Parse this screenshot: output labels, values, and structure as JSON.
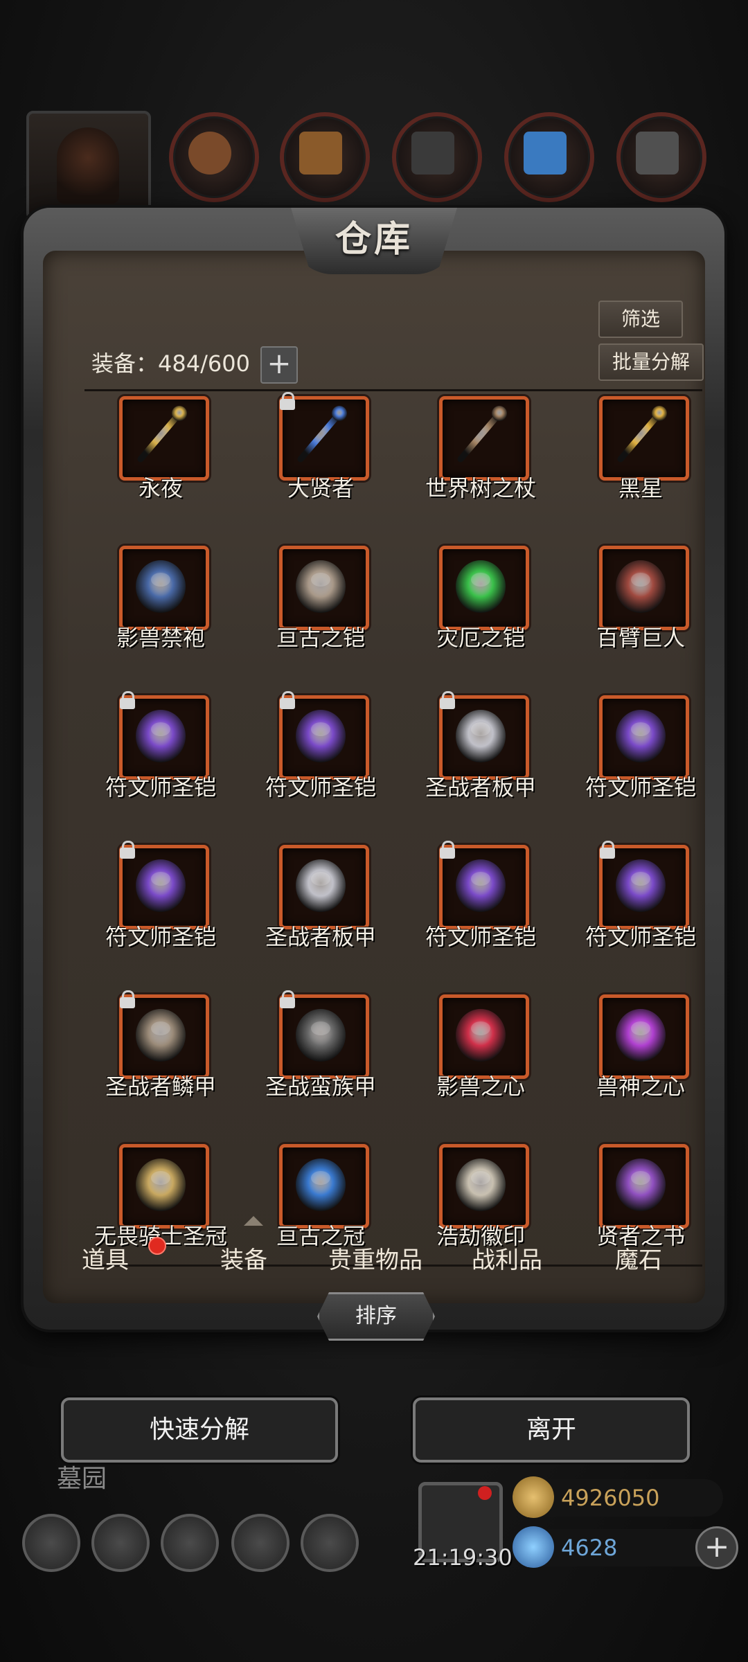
{
  "panel": {
    "title": "仓库",
    "filter_label": "筛选",
    "batch_decompose_label": "批量分解",
    "equip_count": "装备：484/600",
    "add_slot_label": "+"
  },
  "items": [
    {
      "name": "永夜",
      "icon": "golden-spear-icon",
      "locked": false,
      "color": "#d8b04a"
    },
    {
      "name": "大贤者",
      "icon": "blue-staff-icon",
      "locked": true,
      "color": "#4a7ad8"
    },
    {
      "name": "世界树之杖",
      "icon": "wooden-staff-icon",
      "locked": false,
      "color": "#a08060"
    },
    {
      "name": "黑星",
      "icon": "golden-mace-icon",
      "locked": false,
      "color": "#e0b040"
    },
    {
      "name": "影兽禁袍",
      "icon": "blue-robe-icon",
      "locked": false,
      "color": "#4a6aa8"
    },
    {
      "name": "亘古之铠",
      "icon": "plate-armor-icon",
      "locked": false,
      "color": "#a89888"
    },
    {
      "name": "灾厄之铠",
      "icon": "green-armor-icon",
      "locked": false,
      "color": "#3ac04a"
    },
    {
      "name": "百臂巨人",
      "icon": "red-armor-icon",
      "locked": false,
      "color": "#a04a40"
    },
    {
      "name": "符文师圣铠",
      "icon": "purple-armor-icon",
      "locked": true,
      "color": "#7a4ac8"
    },
    {
      "name": "符文师圣铠",
      "icon": "purple-armor-icon",
      "locked": true,
      "color": "#7a4ac8"
    },
    {
      "name": "圣战者板甲",
      "icon": "silver-armor-icon",
      "locked": true,
      "color": "#c0c0c8"
    },
    {
      "name": "符文师圣铠",
      "icon": "purple-armor-icon",
      "locked": false,
      "color": "#7a4ac8"
    },
    {
      "name": "符文师圣铠",
      "icon": "purple-armor-icon",
      "locked": true,
      "color": "#7a4ac8"
    },
    {
      "name": "圣战者板甲",
      "icon": "silver-armor-icon",
      "locked": false,
      "color": "#c0c0c8"
    },
    {
      "name": "符文师圣铠",
      "icon": "purple-armor-icon",
      "locked": true,
      "color": "#7a4ac8"
    },
    {
      "name": "符文师圣铠",
      "icon": "purple-armor-icon",
      "locked": true,
      "color": "#7a4ac8"
    },
    {
      "name": "圣战者鳞甲",
      "icon": "scale-armor-icon",
      "locked": true,
      "color": "#9a8a78"
    },
    {
      "name": "圣战蛮族甲",
      "icon": "dark-armor-icon",
      "locked": true,
      "color": "#6a6a6a"
    },
    {
      "name": "影兽之心",
      "icon": "red-heart-gem-icon",
      "locked": false,
      "color": "#d0304a"
    },
    {
      "name": "兽神之心",
      "icon": "purple-heart-gem-icon",
      "locked": false,
      "color": "#b040d0"
    },
    {
      "name": "无畏骑士圣冠",
      "icon": "knight-helmet-icon",
      "locked": false,
      "color": "#c8a860"
    },
    {
      "name": "亘古之冠",
      "icon": "blue-crown-icon",
      "locked": false,
      "color": "#3a7ad0"
    },
    {
      "name": "浩劫徽印",
      "icon": "silver-seal-icon",
      "locked": false,
      "color": "#c8c0b0"
    },
    {
      "name": "贤者之书",
      "icon": "purple-book-icon",
      "locked": false,
      "color": "#9050c0"
    }
  ],
  "tabs": [
    {
      "label": "道具",
      "active": false,
      "badge": true
    },
    {
      "label": "装备",
      "active": true,
      "badge": false
    },
    {
      "label": "贵重物品",
      "active": false,
      "badge": false
    },
    {
      "label": "战利品",
      "active": false,
      "badge": false
    },
    {
      "label": "魔石",
      "active": false,
      "badge": false
    }
  ],
  "sort_label": "排序",
  "actions": {
    "quick_decompose_label": "快速分解",
    "leave_label": "离开"
  },
  "hud": {
    "location": "墓园",
    "timer": "21:19:30",
    "gold": "4926050",
    "gems": "4628",
    "gem_plus_label": "+"
  },
  "colors": {
    "slot_border": "#c95a2a",
    "badge_red": "#e02a20",
    "gold_text": "#c9a25a",
    "gem_text": "#6ea6d8"
  }
}
